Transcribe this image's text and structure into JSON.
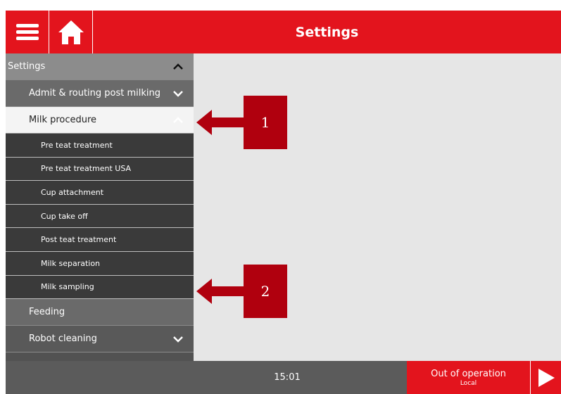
{
  "header": {
    "title": "Settings",
    "menu_icon": "hamburger-menu-icon",
    "home_icon": "home-icon"
  },
  "sidebar": {
    "section": {
      "label": "Settings",
      "icon": "chevron-up-icon"
    },
    "items": [
      {
        "label": "Admit & routing post milking",
        "icon": "chevron-down-icon"
      },
      {
        "label": "Milk procedure",
        "icon": "chevron-up-icon",
        "active": true
      },
      {
        "label": "Pre teat treatment"
      },
      {
        "label": "Pre teat treatment USA"
      },
      {
        "label": "Cup attachment"
      },
      {
        "label": "Cup take off"
      },
      {
        "label": "Post teat treatment"
      },
      {
        "label": "Milk separation"
      },
      {
        "label": "Milk sampling"
      },
      {
        "label": "Feeding"
      },
      {
        "label": "Robot cleaning",
        "icon": "chevron-down-icon"
      }
    ]
  },
  "footer": {
    "time": "15:01",
    "status": "Out of operation",
    "status_sub": "Local",
    "play_icon": "play-icon"
  },
  "callouts": [
    {
      "label": "1"
    },
    {
      "label": "2"
    }
  ],
  "colors": {
    "brand_red": "#e3141d",
    "callout_red": "#b0000e",
    "content_bg": "#e6e6e6"
  }
}
